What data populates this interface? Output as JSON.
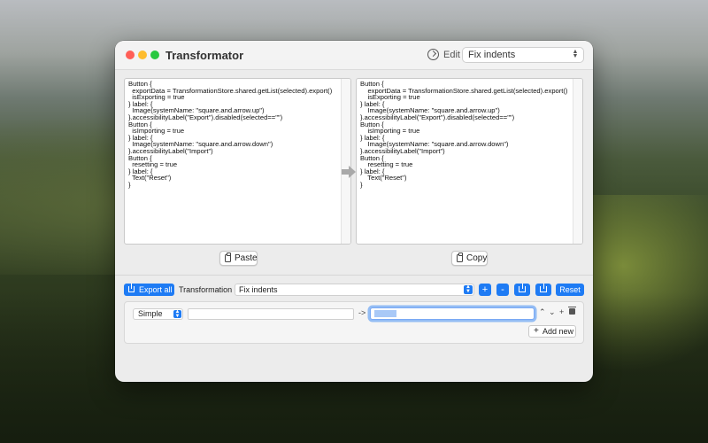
{
  "window": {
    "title": "Transformator",
    "edit_label": "Edit",
    "mode_select": "Fix indents"
  },
  "editors": {
    "input_code": "Button {\n  exportData = TransformationStore.shared.getList(selected).export()\n  isExporting = true\n} label: {\n  Image(systemName: \"square.and.arrow.up\")\n}.accessibilityLabel(\"Export\").disabled(selected==\"\")\nButton {\n  isImporting = true\n} label: {\n  Image(systemName: \"square.and.arrow.down\")\n}.accessibilityLabel(\"Import\")\nButton {\n  resetting = true\n} label: {\n  Text(\"Reset\")\n}",
    "output_code": "Button {\n    exportData = TransformationStore.shared.getList(selected).export()\n    isExporting = true\n} label: {\n    Image(systemName: \"square.and.arrow.up\")\n}.accessibilityLabel(\"Export\").disabled(selected==\"\")\nButton {\n    isImporting = true\n} label: {\n    Image(systemName: \"square.and.arrow.down\")\n}.accessibilityLabel(\"Import\")\nButton {\n    resetting = true\n} label: {\n    Text(\"Reset\")\n}",
    "paste_label": "Paste",
    "copy_label": "Copy"
  },
  "toolbar": {
    "export_all_label": "Export all",
    "transformation_label": "Transformation",
    "transformation_select": "Fix indents",
    "plus_label": "+",
    "minus_label": "-",
    "reset_label": "Reset"
  },
  "rule": {
    "type_select": "Simple",
    "find_value": "",
    "arrow_text": "->",
    "replace_value": "",
    "add_new_label": "Add new"
  },
  "icons": {
    "edit": "timer-icon",
    "paste": "clipboard-icon",
    "copy": "clipboard-icon",
    "export": "share-icon",
    "import": "import-icon",
    "trash": "trash-icon"
  },
  "colors": {
    "accent": "#1e7bf4",
    "close": "#ff5f57",
    "minimize": "#febc2e",
    "maximize": "#28c840"
  }
}
